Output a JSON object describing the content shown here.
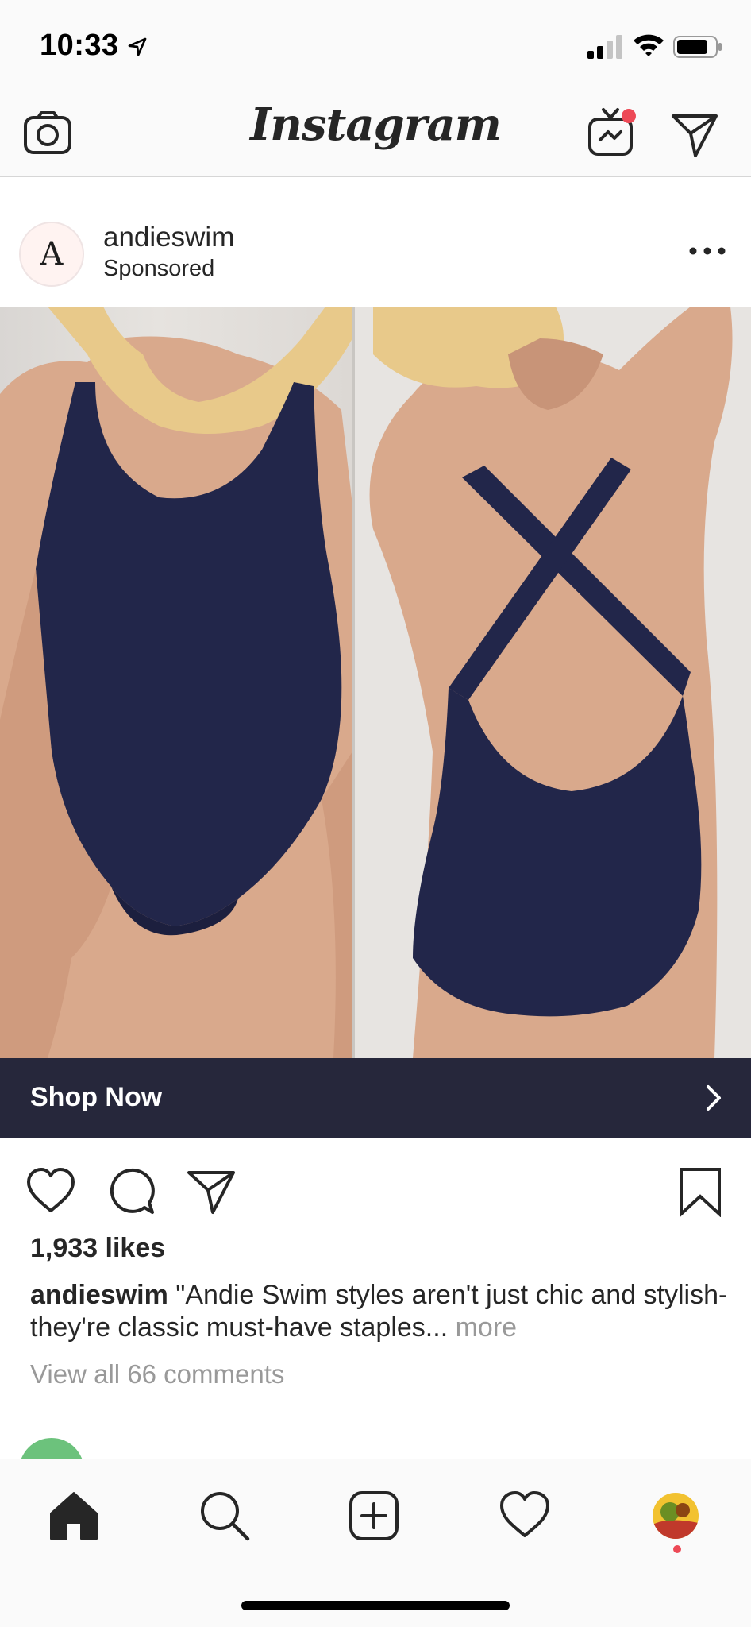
{
  "status_bar": {
    "time": "10:33"
  },
  "header": {
    "logo_text": "Instagram",
    "notification_color": "#ed4956"
  },
  "post": {
    "avatar_letter": "A",
    "username": "andieswim",
    "sponsored_label": "Sponsored",
    "swimsuit_color": "#22264a",
    "cta_label": "Shop Now",
    "cta_color": "#26273b",
    "likes": "1,933 likes",
    "caption_user": "andieswim",
    "caption_text": " \"Andie Swim styles aren't just chic and stylish- they're classic must-have staples...",
    "caption_more": " more",
    "comments_link": "View all 66 comments"
  },
  "icons": {
    "header": [
      "camera-icon",
      "igtv-icon",
      "direct-message-icon"
    ],
    "post": [
      "more-options-icon",
      "chevron-right-icon",
      "heart-icon",
      "comment-icon",
      "share-icon",
      "bookmark-icon"
    ],
    "tab_bar": [
      "home-icon",
      "search-icon",
      "add-post-icon",
      "activity-heart-icon",
      "profile-avatar"
    ]
  }
}
